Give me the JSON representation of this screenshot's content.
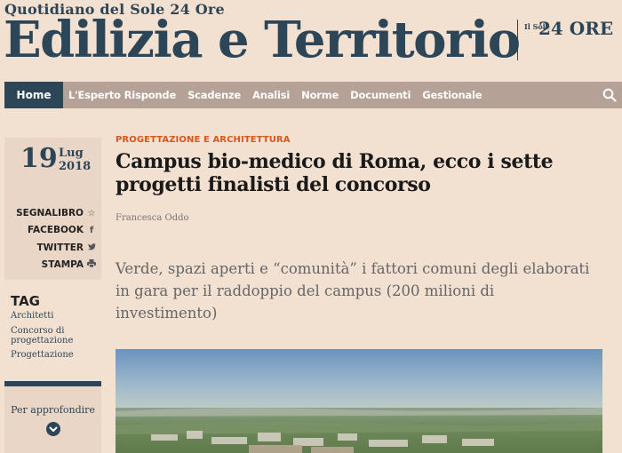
{
  "masthead": {
    "tagline": "Quotidiano del Sole 24 Ore",
    "brand": "Edilizia e Territorio",
    "logo_small": "Il Sole",
    "logo_big": "24 ORE"
  },
  "nav": {
    "home": "Home",
    "items": [
      "L'Esperto Risponde",
      "Scadenze",
      "Analisi",
      "Norme",
      "Documenti",
      "Gestionale"
    ]
  },
  "date": {
    "day": "19",
    "month": "Lug",
    "year": "2018"
  },
  "share": {
    "bookmark": "SEGNALIBRO",
    "facebook": "FACEBOOK",
    "twitter": "TWITTER",
    "print": "STAMPA"
  },
  "tags": {
    "title": "TAG",
    "items": [
      "Architetti",
      "Concorso di progettazione",
      "Progettazione"
    ]
  },
  "related": {
    "label": "Per approfondire"
  },
  "article": {
    "kicker": "PROGETTAZIONE E ARCHITETTURA",
    "headline": "Campus bio-medico di Roma, ecco i sette progetti finalisti del concorso",
    "author": "Francesca Oddo",
    "subhead": "Verde, spazi aperti e “comunità” i fattori comuni degli elaborati in gara per il raddoppio del campus (200 milioni di investimento)"
  },
  "colors": {
    "background": "#f2e0d1",
    "brand_blue": "#2c4658",
    "nav_bar": "#b5a196",
    "kicker_orange": "#d8561a"
  },
  "icons": [
    "star-icon",
    "facebook-icon",
    "twitter-icon",
    "print-icon",
    "search-icon",
    "chevron-down-icon"
  ]
}
